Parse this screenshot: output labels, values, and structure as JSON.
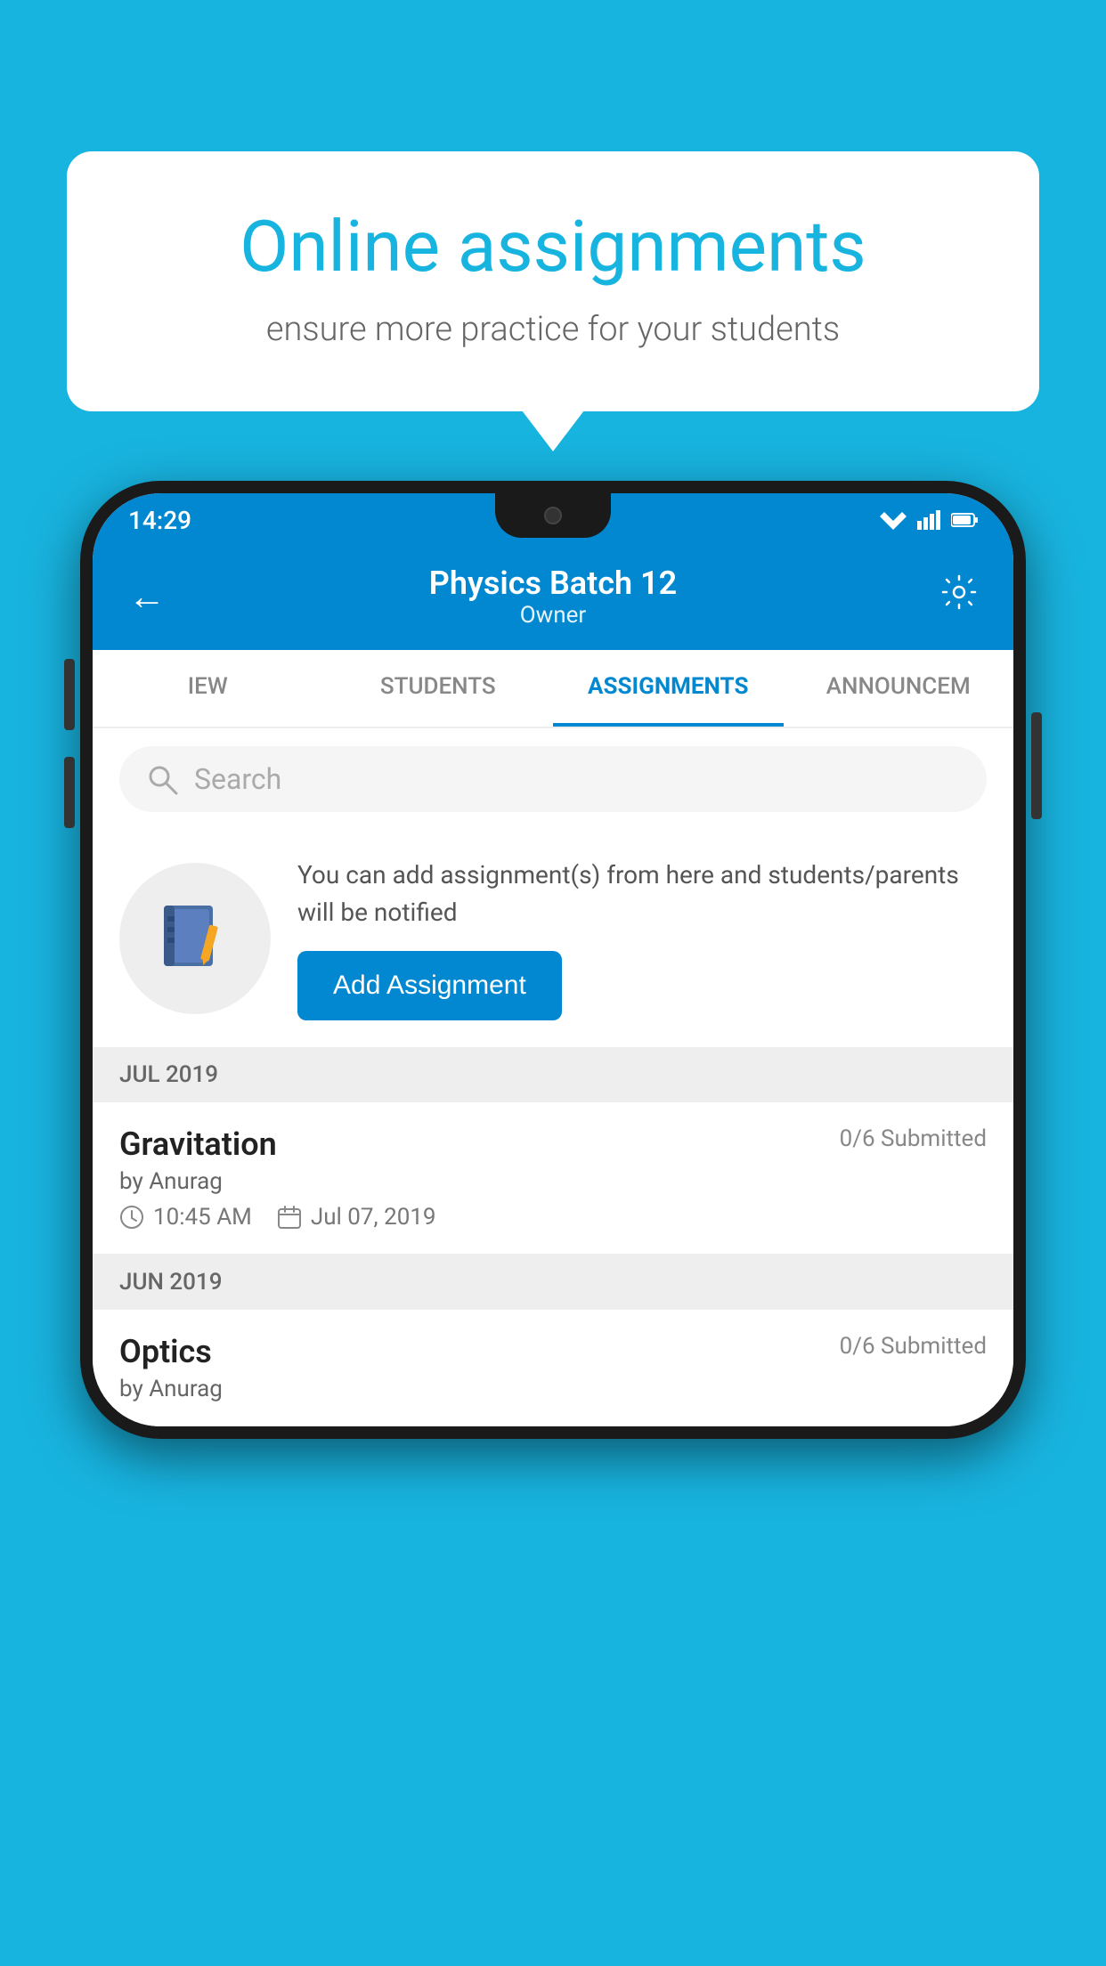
{
  "background_color": "#18B4E0",
  "speech_bubble": {
    "title": "Online assignments",
    "subtitle": "ensure more practice for your students"
  },
  "status_bar": {
    "time": "14:29",
    "wifi": "▼",
    "signal": "▲",
    "battery": "▮"
  },
  "app_header": {
    "title": "Physics Batch 12",
    "subtitle": "Owner",
    "back_label": "←",
    "settings_label": "⚙"
  },
  "tabs": [
    {
      "label": "IEW",
      "active": false
    },
    {
      "label": "STUDENTS",
      "active": false
    },
    {
      "label": "ASSIGNMENTS",
      "active": true
    },
    {
      "label": "ANNOUNCEM",
      "active": false
    }
  ],
  "search": {
    "placeholder": "Search"
  },
  "promo": {
    "text": "You can add assignment(s) from here and students/parents will be notified",
    "button_label": "Add Assignment"
  },
  "month_sections": [
    {
      "month_label": "JUL 2019",
      "assignments": [
        {
          "name": "Gravitation",
          "submitted": "0/6 Submitted",
          "by": "by Anurag",
          "time": "10:45 AM",
          "date": "Jul 07, 2019"
        }
      ]
    },
    {
      "month_label": "JUN 2019",
      "assignments": [
        {
          "name": "Optics",
          "submitted": "0/6 Submitted",
          "by": "by Anurag",
          "time": "",
          "date": ""
        }
      ]
    }
  ]
}
